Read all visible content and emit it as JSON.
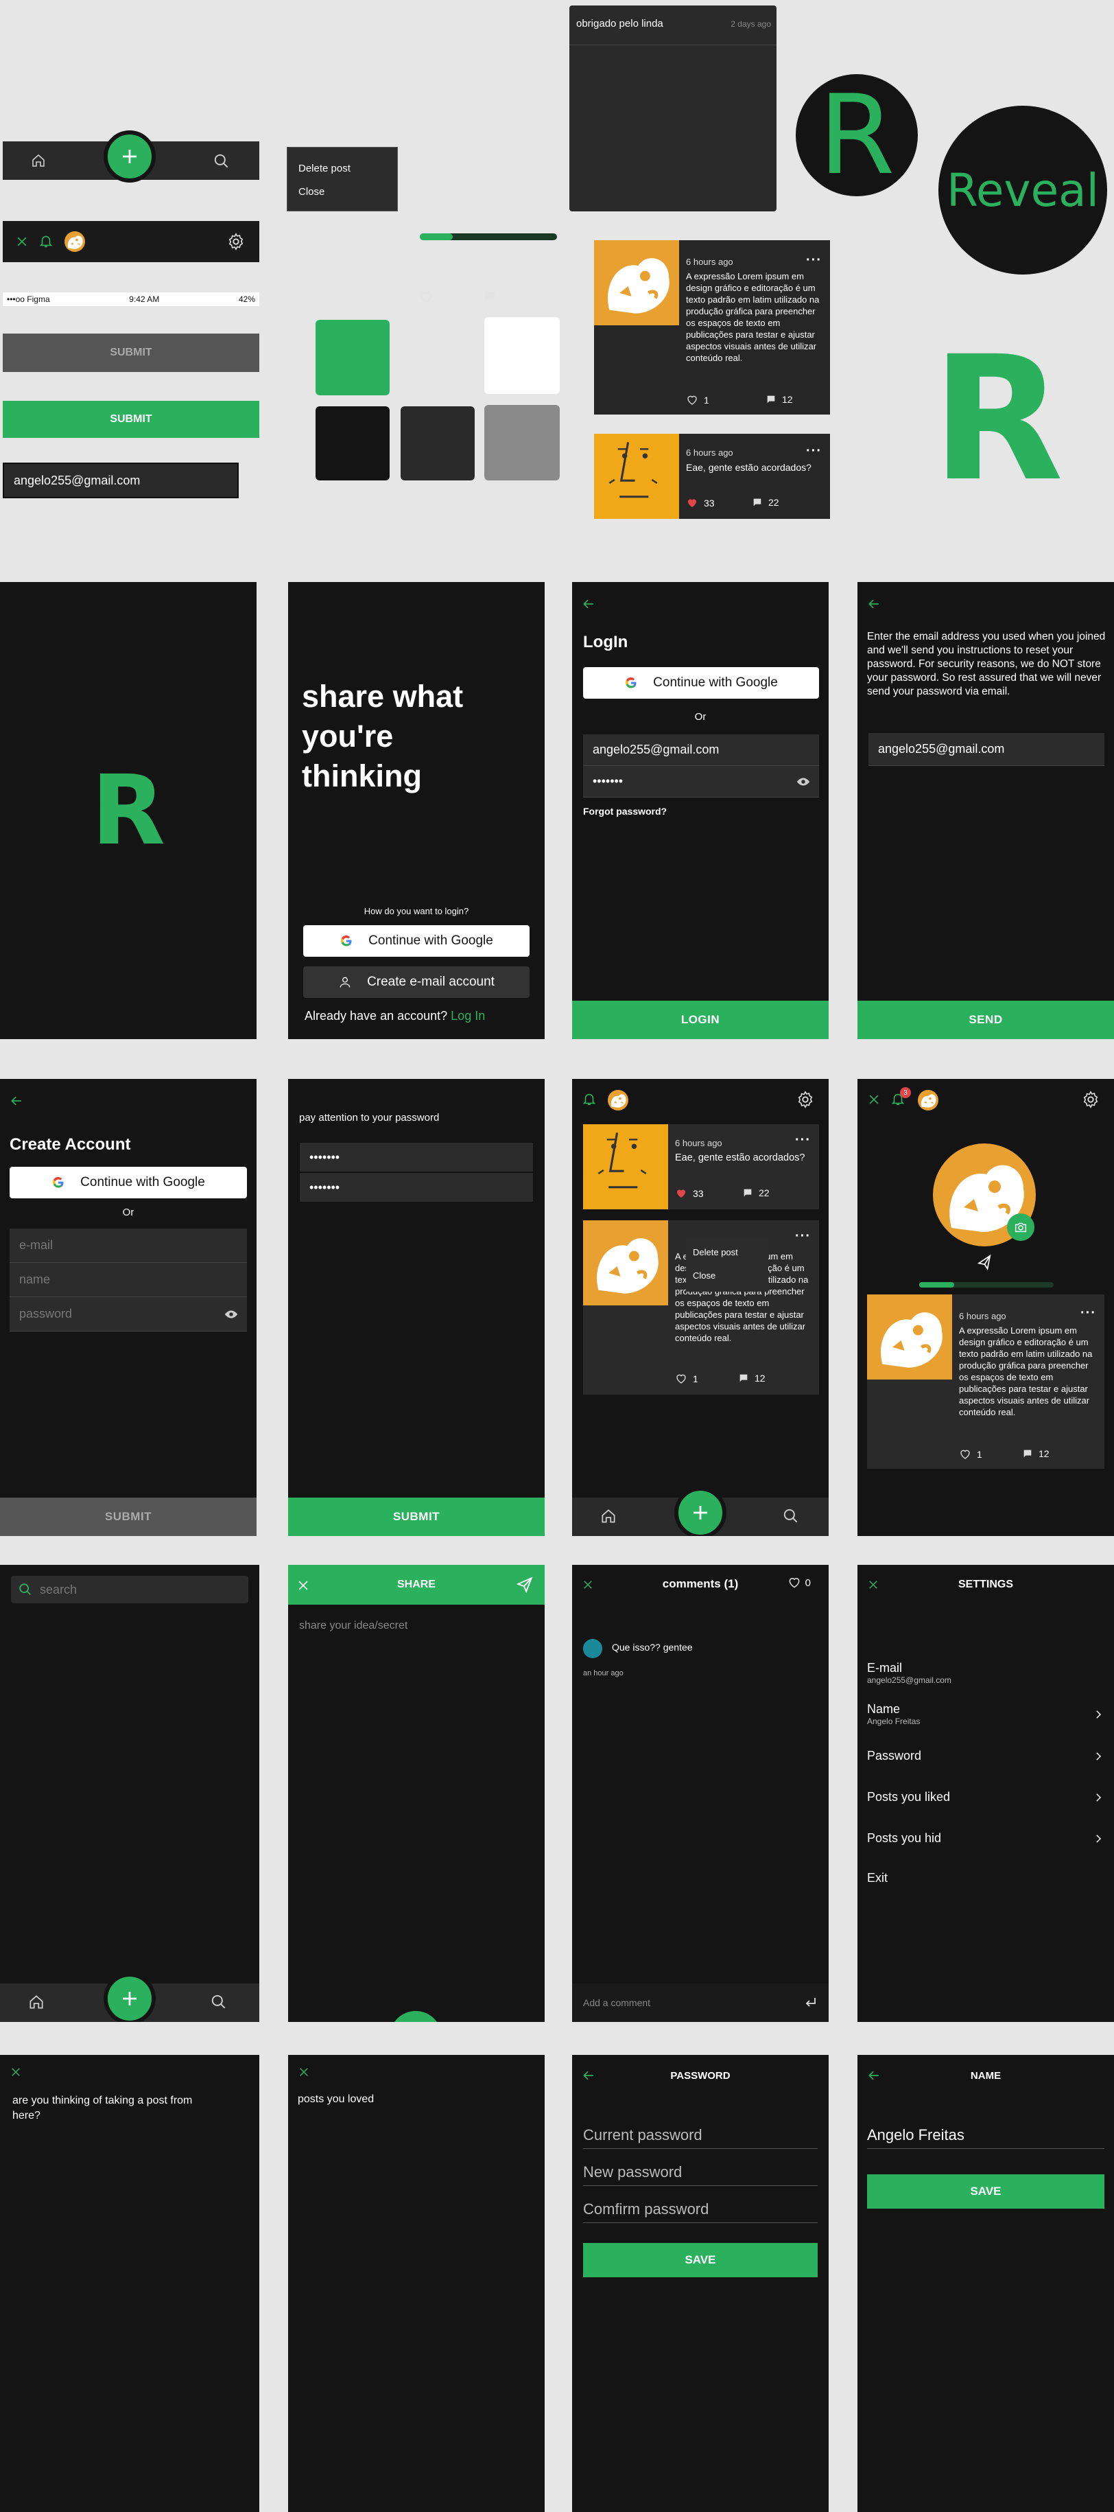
{
  "components": {
    "notification": {
      "text": "obrigado pelo linda",
      "time": "2 days ago"
    },
    "context_menu": {
      "items": [
        "Delete post",
        "Close"
      ]
    },
    "logo_text": "Reveal",
    "logo_letter": "R",
    "status_bar": {
      "carrier": "•••oo Figma",
      "time": "9:42 AM",
      "battery": "42%"
    },
    "submit_disabled": "SUBMIT",
    "submit_enabled": "SUBMIT",
    "email_value": "angelo255@gmail.com",
    "card1": {
      "time": "6 hours ago",
      "text": "A expressão Lorem ipsum em design gráfico e editoração é um texto padrão em latim utilizado na produção gráfica para preencher os espaços de texto em publicações para testar e ajustar aspectos visuais antes de utilizar conteúdo real.",
      "likes": "1",
      "comments": "12"
    },
    "card2": {
      "time": "6 hours ago",
      "text": "Eae, gente estão acordados?",
      "likes": "33",
      "comments": "22"
    },
    "swatches": [
      "#2bb05e",
      "#ffffff",
      "#141414",
      "#2a2a2a",
      "#8a8a8a"
    ]
  },
  "splash": {
    "letter": "R"
  },
  "welcome": {
    "headline": "share what you're thinking",
    "question": "How do you want to login?",
    "google": "Continue with Google",
    "create": "Create e-mail account",
    "have_account": "Already have an account?",
    "login_link": "Log In"
  },
  "login": {
    "title": "LogIn",
    "google": "Continue with Google",
    "or": "Or",
    "email": "angelo255@gmail.com",
    "password": "•••••••",
    "forgot": "Forgot password?",
    "button": "LOGIN"
  },
  "reset": {
    "info": "Enter the email address you used when you joined and we'll send you instructions to reset your password. For security reasons, we do NOT store your password. So rest assured that we will never send your password via email.",
    "email": "angelo255@gmail.com",
    "button": "SEND"
  },
  "create_account": {
    "title": "Create Account",
    "google": "Continue with Google",
    "or": "Or",
    "email_ph": "e-mail",
    "name_ph": "name",
    "password_ph": "password",
    "button": "SUBMIT"
  },
  "confirm_pw": {
    "note": "pay attention to your password",
    "pw1": "•••••••",
    "pw2": "•••••••",
    "button": "SUBMIT"
  },
  "feed": {
    "post1": {
      "time": "6 hours ago",
      "text": "Eae, gente estão acordados?",
      "likes": "33",
      "comments": "22"
    },
    "post2": {
      "time": "6 hours ago",
      "text": "A expressão Lorem ipsum em design gráfico e editoração é um texto padrão em latim utilizado na produção gráfica para preencher os espaços de texto em publicações para testar e ajustar aspectos visuais antes de utilizar conteúdo real.",
      "likes": "1",
      "comments": "12"
    },
    "menu": [
      "Delete post",
      "Close"
    ]
  },
  "profile": {
    "badge": "3",
    "post": {
      "time": "6 hours ago",
      "text": "A expressão Lorem ipsum em design gráfico e editoração é um texto padrão em latim utilizado na produção gráfica para preencher os espaços de texto em publicações para testar e ajustar aspectos visuais antes de utilizar conteúdo real.",
      "likes": "1",
      "comments": "12"
    }
  },
  "search": {
    "placeholder": "search"
  },
  "share": {
    "title": "SHARE",
    "placeholder": "share your idea/secret"
  },
  "comments": {
    "title": "comments (1)",
    "likes": "0",
    "comment": "Que isso?? gentee",
    "time": "an hour ago",
    "add_placeholder": "Add a comment"
  },
  "settings": {
    "title": "SETTINGS",
    "email_label": "E-mail",
    "email_value": "angelo255@gmail.com",
    "name_label": "Name",
    "name_value": "Angelo Freitas",
    "password": "Password",
    "liked": "Posts you liked",
    "hid": "Posts you hid",
    "exit": "Exit"
  },
  "remove_post": {
    "question": "are you thinking of taking a post from here?"
  },
  "loved": {
    "title": "posts you loved"
  },
  "password_screen": {
    "title": "PASSWORD",
    "current": "Current password",
    "new": "New password",
    "confirm": "Comfirm password",
    "button": "SAVE"
  },
  "name_screen": {
    "title": "NAME",
    "value": "Angelo Freitas",
    "button": "SAVE"
  }
}
